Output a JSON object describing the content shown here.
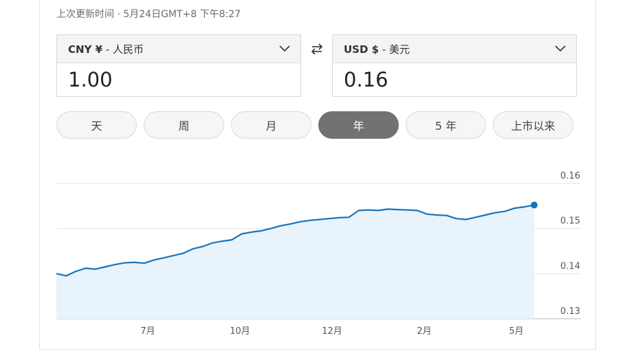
{
  "updated": "上次更新时间 · 5月24日GMT+8 下午8:27",
  "from": {
    "code": "CNY ¥",
    "name": " - 人民币",
    "amount": "1.00"
  },
  "to": {
    "code": "USD $",
    "name": " - 美元",
    "amount": "0.16"
  },
  "ranges": [
    {
      "label": "天",
      "active": false
    },
    {
      "label": "周",
      "active": false
    },
    {
      "label": "月",
      "active": false
    },
    {
      "label": "年",
      "active": true
    },
    {
      "label": "5 年",
      "active": false
    },
    {
      "label": "上市以来",
      "active": false
    }
  ],
  "colors": {
    "line": "#1a73b8",
    "fill": "#e8f3fc",
    "active_range": "#727272"
  },
  "chart_data": {
    "type": "area",
    "x_ticks": [
      "7月",
      "10月",
      "12月",
      "2月",
      "5月"
    ],
    "y_ticks": [
      "0.13",
      "0.14",
      "0.15",
      "0.16"
    ],
    "ylim": [
      0.13,
      0.16
    ],
    "grid": true,
    "series": [
      {
        "values": [
          0.14,
          0.1395,
          0.1405,
          0.1412,
          0.141,
          0.1415,
          0.142,
          0.1424,
          0.1425,
          0.1423,
          0.143,
          0.1435,
          0.144,
          0.1445,
          0.1455,
          0.146,
          0.1468,
          0.1472,
          0.1475,
          0.1488,
          0.1492,
          0.1495,
          0.15,
          0.1506,
          0.151,
          0.1515,
          0.1518,
          0.152,
          0.1522,
          0.1524,
          0.1525,
          0.154,
          0.1541,
          0.154,
          0.1543,
          0.1542,
          0.1541,
          0.154,
          0.1532,
          0.153,
          0.1529,
          0.1522,
          0.152,
          0.1525,
          0.153,
          0.1535,
          0.1538,
          0.1545,
          0.1548,
          0.1552
        ]
      }
    ]
  }
}
